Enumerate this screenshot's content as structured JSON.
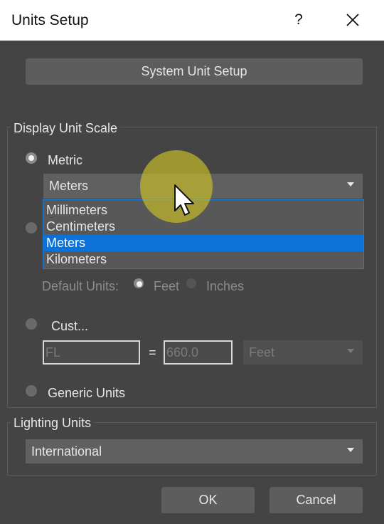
{
  "titlebar": {
    "title": "Units Setup",
    "help": "?"
  },
  "system_unit_setup": {
    "label": "System Unit Setup"
  },
  "display_unit_scale": {
    "label": "Display Unit Scale",
    "metric": {
      "label": "Metric",
      "selected": "Meters",
      "options": [
        "Millimeters",
        "Centimeters",
        "Meters",
        "Kilometers"
      ]
    },
    "default_units": {
      "label": "Default Units:",
      "feet": "Feet",
      "inches": "Inches"
    },
    "custom": {
      "label": "Cust...",
      "name_value": "FL",
      "equals": "=",
      "amount_value": "660.0",
      "unit": "Feet"
    },
    "generic": {
      "label": "Generic Units"
    }
  },
  "lighting_units": {
    "label": "Lighting Units",
    "selected": "International"
  },
  "buttons": {
    "ok": "OK",
    "cancel": "Cancel"
  },
  "colors": {
    "selection": "#0b72d9",
    "highlight": "#c8be28"
  }
}
